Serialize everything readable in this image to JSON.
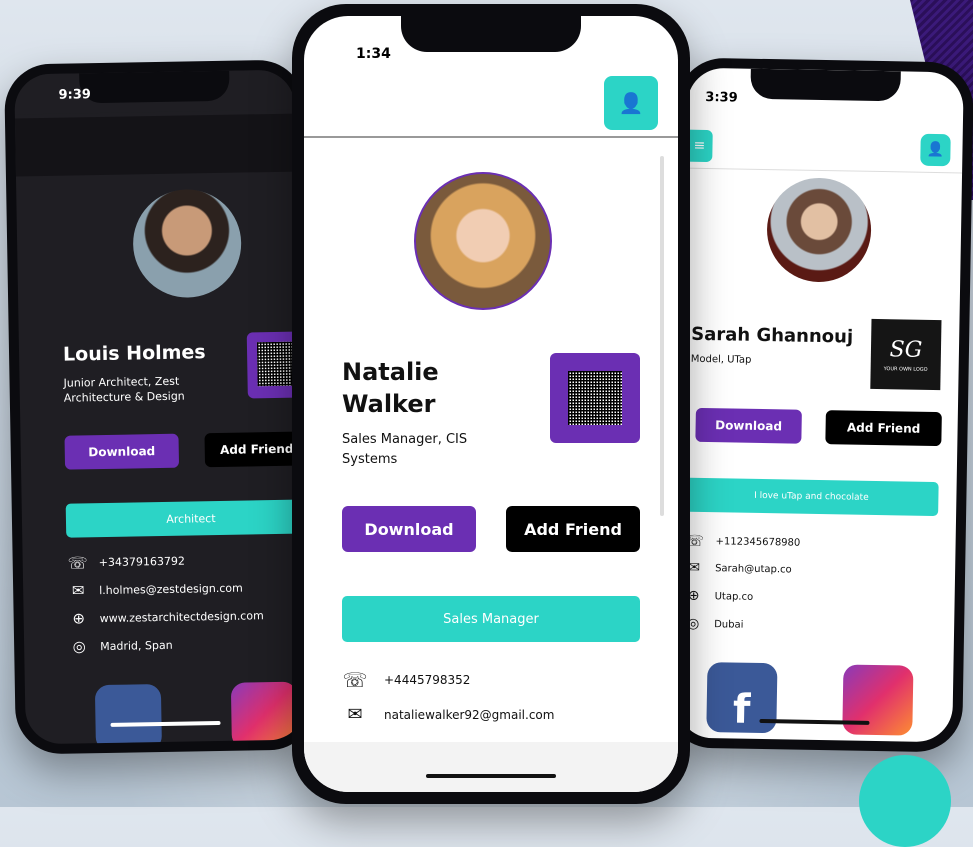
{
  "colors": {
    "accent_purple": "#6b2fb3",
    "accent_teal": "#2cd4c6",
    "dark_bg": "#1f1e23",
    "light_bg": "#ffffff"
  },
  "left_phone": {
    "time": "9:39",
    "name": "Louis Holmes",
    "title": "Junior Architect, Zest Architecture & Design",
    "download_label": "Download",
    "add_friend_label": "Add Friend",
    "tag": "Architect",
    "phone": "+34379163792",
    "email": "l.holmes@zestdesign.com",
    "website": "www.zestarchitectdesign.com",
    "location": "Madrid, Span"
  },
  "center_phone": {
    "time": "1:34",
    "name": "Natalie Walker",
    "title": "Sales Manager, CIS Systems",
    "download_label": "Download",
    "add_friend_label": "Add Friend",
    "tag": "Sales Manager",
    "phone": "+4445798352",
    "email": "nataliewalker92@gmail.com"
  },
  "right_phone": {
    "time": "3:39",
    "name": "Sarah Ghannouj",
    "title": "Model, UTap",
    "logo_text": "SG",
    "logo_sub": "YOUR OWN LOGO",
    "download_label": "Download",
    "add_friend_label": "Add Friend",
    "tag": "I love uTap and chocolate",
    "phone": "+112345678980",
    "email": "Sarah@utap.co",
    "website": "Utap.co",
    "location": "Dubai"
  },
  "icons": {
    "user": "user-icon",
    "menu": "menu-icon",
    "phone": "phone-icon",
    "email": "envelope-icon",
    "web": "globe-icon",
    "location": "location-icon",
    "facebook": "facebook-icon",
    "instagram": "instagram-icon"
  }
}
